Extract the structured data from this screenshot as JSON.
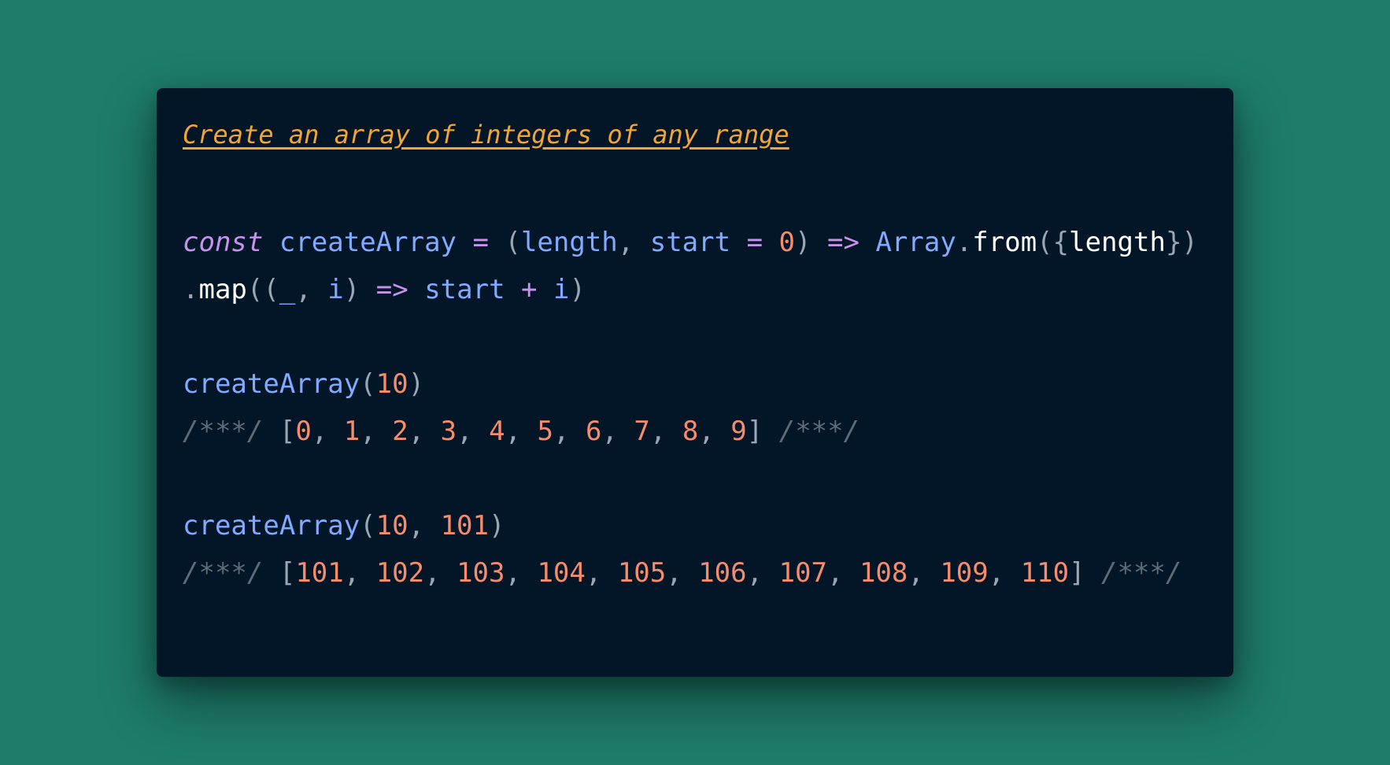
{
  "title": "Create an array of integers of any range",
  "colors": {
    "background": "#1e7c6a",
    "editor_bg": "#021628",
    "title": "#f2a531",
    "keyword": "#c792ea",
    "identifier": "#82aaff",
    "number": "#f78c6c",
    "plain": "#ffffff",
    "punctuation": "#9aa6b3",
    "comment": "#5f6b77"
  },
  "code_lines": [
    {
      "tokens": [
        {
          "text": "const",
          "kind": "keyword",
          "italic": true
        },
        {
          "text": " ",
          "kind": "plain"
        },
        {
          "text": "createArray",
          "kind": "identifier"
        },
        {
          "text": " ",
          "kind": "plain"
        },
        {
          "text": "=",
          "kind": "keyword"
        },
        {
          "text": " ",
          "kind": "plain"
        },
        {
          "text": "(",
          "kind": "punctuation"
        },
        {
          "text": "length",
          "kind": "identifier"
        },
        {
          "text": ", ",
          "kind": "punctuation"
        },
        {
          "text": "start",
          "kind": "identifier"
        },
        {
          "text": " ",
          "kind": "plain"
        },
        {
          "text": "=",
          "kind": "keyword"
        },
        {
          "text": " ",
          "kind": "plain"
        },
        {
          "text": "0",
          "kind": "number"
        },
        {
          "text": ")",
          "kind": "punctuation"
        },
        {
          "text": " ",
          "kind": "plain"
        },
        {
          "text": "=>",
          "kind": "keyword"
        },
        {
          "text": " ",
          "kind": "plain"
        },
        {
          "text": "Array",
          "kind": "identifier"
        },
        {
          "text": ".",
          "kind": "punctuation"
        },
        {
          "text": "from",
          "kind": "plain"
        },
        {
          "text": "({",
          "kind": "punctuation"
        },
        {
          "text": "length",
          "kind": "plain"
        },
        {
          "text": "})",
          "kind": "punctuation"
        }
      ]
    },
    {
      "tokens": [
        {
          "text": ".",
          "kind": "punctuation"
        },
        {
          "text": "map",
          "kind": "plain"
        },
        {
          "text": "((",
          "kind": "punctuation"
        },
        {
          "text": "_",
          "kind": "identifier"
        },
        {
          "text": ", ",
          "kind": "punctuation"
        },
        {
          "text": "i",
          "kind": "identifier"
        },
        {
          "text": ")",
          "kind": "punctuation"
        },
        {
          "text": " ",
          "kind": "plain"
        },
        {
          "text": "=>",
          "kind": "keyword"
        },
        {
          "text": " ",
          "kind": "plain"
        },
        {
          "text": "start",
          "kind": "identifier"
        },
        {
          "text": " ",
          "kind": "plain"
        },
        {
          "text": "+",
          "kind": "keyword"
        },
        {
          "text": " ",
          "kind": "plain"
        },
        {
          "text": "i",
          "kind": "identifier"
        },
        {
          "text": ")",
          "kind": "punctuation"
        }
      ]
    },
    {
      "tokens": []
    },
    {
      "tokens": [
        {
          "text": "createArray",
          "kind": "identifier"
        },
        {
          "text": "(",
          "kind": "punctuation"
        },
        {
          "text": "10",
          "kind": "number"
        },
        {
          "text": ")",
          "kind": "punctuation"
        }
      ]
    },
    {
      "tokens": [
        {
          "text": "/***/",
          "kind": "comment",
          "italic": true
        },
        {
          "text": " ",
          "kind": "plain"
        },
        {
          "text": "[",
          "kind": "punctuation"
        },
        {
          "text": "0",
          "kind": "number"
        },
        {
          "text": ", ",
          "kind": "punctuation"
        },
        {
          "text": "1",
          "kind": "number"
        },
        {
          "text": ", ",
          "kind": "punctuation"
        },
        {
          "text": "2",
          "kind": "number"
        },
        {
          "text": ", ",
          "kind": "punctuation"
        },
        {
          "text": "3",
          "kind": "number"
        },
        {
          "text": ", ",
          "kind": "punctuation"
        },
        {
          "text": "4",
          "kind": "number"
        },
        {
          "text": ", ",
          "kind": "punctuation"
        },
        {
          "text": "5",
          "kind": "number"
        },
        {
          "text": ", ",
          "kind": "punctuation"
        },
        {
          "text": "6",
          "kind": "number"
        },
        {
          "text": ", ",
          "kind": "punctuation"
        },
        {
          "text": "7",
          "kind": "number"
        },
        {
          "text": ", ",
          "kind": "punctuation"
        },
        {
          "text": "8",
          "kind": "number"
        },
        {
          "text": ", ",
          "kind": "punctuation"
        },
        {
          "text": "9",
          "kind": "number"
        },
        {
          "text": "]",
          "kind": "punctuation"
        },
        {
          "text": " ",
          "kind": "plain"
        },
        {
          "text": "/***/",
          "kind": "comment",
          "italic": true
        }
      ]
    },
    {
      "tokens": []
    },
    {
      "tokens": [
        {
          "text": "createArray",
          "kind": "identifier"
        },
        {
          "text": "(",
          "kind": "punctuation"
        },
        {
          "text": "10",
          "kind": "number"
        },
        {
          "text": ", ",
          "kind": "punctuation"
        },
        {
          "text": "101",
          "kind": "number"
        },
        {
          "text": ")",
          "kind": "punctuation"
        }
      ]
    },
    {
      "tokens": [
        {
          "text": "/***/",
          "kind": "comment",
          "italic": true
        },
        {
          "text": " ",
          "kind": "plain"
        },
        {
          "text": "[",
          "kind": "punctuation"
        },
        {
          "text": "101",
          "kind": "number"
        },
        {
          "text": ", ",
          "kind": "punctuation"
        },
        {
          "text": "102",
          "kind": "number"
        },
        {
          "text": ", ",
          "kind": "punctuation"
        },
        {
          "text": "103",
          "kind": "number"
        },
        {
          "text": ", ",
          "kind": "punctuation"
        },
        {
          "text": "104",
          "kind": "number"
        },
        {
          "text": ", ",
          "kind": "punctuation"
        },
        {
          "text": "105",
          "kind": "number"
        },
        {
          "text": ", ",
          "kind": "punctuation"
        },
        {
          "text": "106",
          "kind": "number"
        },
        {
          "text": ", ",
          "kind": "punctuation"
        },
        {
          "text": "107",
          "kind": "number"
        },
        {
          "text": ", ",
          "kind": "punctuation"
        },
        {
          "text": "108",
          "kind": "number"
        },
        {
          "text": ", ",
          "kind": "punctuation"
        },
        {
          "text": "109",
          "kind": "number"
        },
        {
          "text": ", ",
          "kind": "punctuation"
        },
        {
          "text": "110",
          "kind": "number"
        },
        {
          "text": "]",
          "kind": "punctuation"
        },
        {
          "text": " ",
          "kind": "plain"
        },
        {
          "text": "/***/",
          "kind": "comment",
          "italic": true
        }
      ]
    }
  ]
}
